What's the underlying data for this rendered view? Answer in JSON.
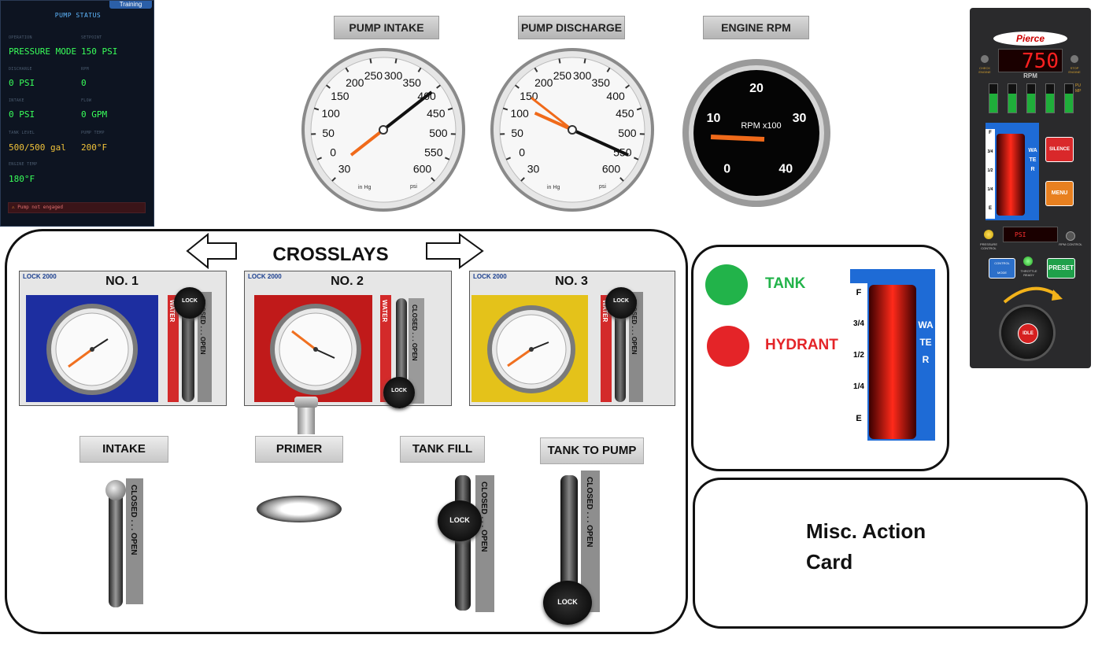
{
  "status_panel": {
    "title": "PUMP STATUS",
    "badge": "Training",
    "fields": [
      {
        "label": "OPERATION",
        "value": "PRESSURE MODE"
      },
      {
        "label": "SETPOINT",
        "value": "150 PSI"
      },
      {
        "label": "DISCHARGE",
        "value": "0 PSI"
      },
      {
        "label": "RPM",
        "value": "0"
      },
      {
        "label": "INTAKE",
        "value": "0 PSI"
      },
      {
        "label": "FLOW",
        "value": "0 GPM"
      },
      {
        "label": "TANK LEVEL",
        "value": "500/500 gal"
      },
      {
        "label": "PUMP TEMP",
        "value": "200°F"
      },
      {
        "label": "ENGINE TEMP",
        "value": "180°F"
      }
    ],
    "warning": "Pump not engaged"
  },
  "gauges": {
    "intake": {
      "label": "PUMP INTAKE",
      "ticks": [
        "30",
        "0",
        "50",
        "100",
        "150",
        "200",
        "250",
        "300",
        "350",
        "400",
        "450",
        "500",
        "550",
        "600"
      ],
      "vac_label": "in Hg",
      "psi_label": "psi",
      "needle_value": 400
    },
    "discharge": {
      "label": "PUMP DISCHARGE",
      "ticks": [
        "30",
        "0",
        "50",
        "100",
        "150",
        "200",
        "250",
        "300",
        "350",
        "400",
        "450",
        "500",
        "550",
        "600"
      ],
      "vac_label": "in Hg",
      "psi_label": "psi",
      "needle_value": 550,
      "setpoint_value": 150
    },
    "rpm": {
      "label": "ENGINE RPM",
      "ticks": [
        "0",
        "10",
        "20",
        "30",
        "40"
      ],
      "unit": "RPM x100",
      "needle_value": 7.5
    }
  },
  "crosslays": {
    "title": "CROSSLAYS",
    "lock_badge": "LOCK 2000",
    "water_tag": "WATER",
    "closed_open": "CLOSED . . . OPEN",
    "lock_knob": "LOCK",
    "cards": [
      {
        "label": "NO. 1",
        "bg": "#1d2ea0"
      },
      {
        "label": "NO. 2",
        "bg": "#c01a1a"
      },
      {
        "label": "NO. 3",
        "bg": "#e4c21a"
      }
    ]
  },
  "controls": {
    "intake": "INTAKE",
    "primer": "PRIMER",
    "tank_fill": "TANK FILL",
    "tank_to_pump": "TANK TO PUMP",
    "closed_open": "CLOSED . . . OPEN",
    "lock_knob": "LOCK"
  },
  "water_source": {
    "tank": "TANK",
    "hydrant": "HYDRANT",
    "tank_color": "#22b34a",
    "hydrant_color": "#e42428",
    "level_labels": [
      "F",
      "3/4",
      "1/2",
      "1/4",
      "E"
    ],
    "water_letters": "WATER",
    "level_fraction": 1.0
  },
  "misc_card": {
    "line1": "Misc. Action",
    "line2": "Card"
  },
  "pierce_panel": {
    "brand": "Pierce",
    "rpm_value": "750",
    "rpm_label": "RPM",
    "check_engine": "CHECK ENGINE",
    "stop_engine": "STOP ENGINE",
    "pump_letters": "PUMP",
    "level_labels": [
      "F",
      "3/4",
      "1/2",
      "1/4",
      "E"
    ],
    "water_letters": "WATER",
    "silence": "SILENCE",
    "menu": "MENU",
    "pressure_control": "PRESSURE CONTROL",
    "rpm_control": "RPM CONTROL",
    "control_mode": "CONTROL MODE",
    "throttle_ready": "THROTTLE READY",
    "preset": "PRESET",
    "idle": "IDLE",
    "psi_display": "PSI"
  }
}
